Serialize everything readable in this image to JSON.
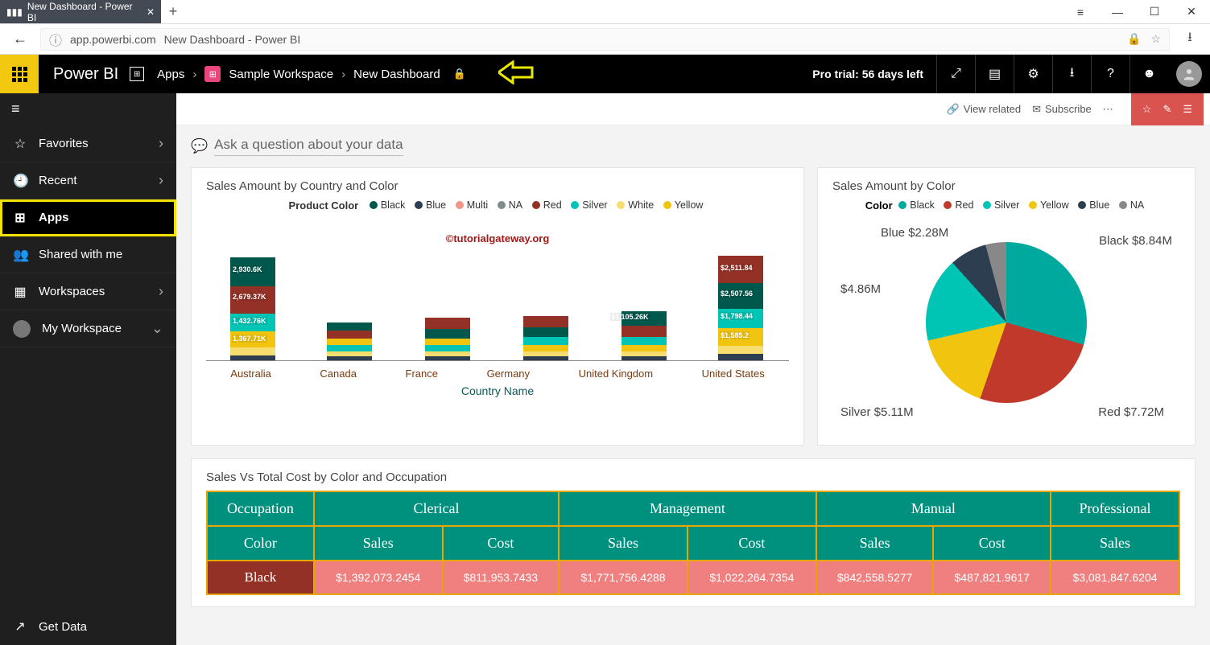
{
  "browser": {
    "tab_title": "New Dashboard - Power BI",
    "url_host": "app.powerbi.com",
    "url_title": "New Dashboard - Power BI"
  },
  "topbar": {
    "brand": "Power BI",
    "crumb_apps": "Apps",
    "crumb_ws": "Sample Workspace",
    "crumb_dash": "New Dashboard",
    "trial": "Pro trial: 56 days left"
  },
  "subbar": {
    "view_related": "View related",
    "subscribe": "Subscribe"
  },
  "sidebar": {
    "fav": "Favorites",
    "recent": "Recent",
    "apps": "Apps",
    "shared": "Shared with me",
    "workspaces": "Workspaces",
    "my_ws": "My Workspace",
    "get_data": "Get Data"
  },
  "qna": {
    "placeholder": "Ask a question about your data"
  },
  "tile1": {
    "title": "Sales Amount by Country and Color",
    "legend_title": "Product Color",
    "watermark": "©tutorialgateway.org",
    "x_title": "Country Name"
  },
  "tile2": {
    "title": "Sales Amount by Color",
    "legend_title": "Color"
  },
  "tile3": {
    "title": "Sales Vs Total Cost by Color and Occupation",
    "occ_hdr": "Occupation",
    "color_hdr": "Color"
  },
  "colors": {
    "black": "#2a2a2a",
    "blue": "#34495e",
    "multi": "#f1948a",
    "na": "#7f8c8d",
    "red": "#943126",
    "silver": "#00c5b5",
    "white": "#f7dc6f",
    "yellow": "#f1c40f",
    "teal": "#00a99d",
    "darkred": "#c0392b"
  },
  "chart_data": [
    {
      "type": "area",
      "title": "Sales Amount by Country and Color",
      "xlabel": "Country Name",
      "ylabel": "",
      "categories": [
        "Australia",
        "Canada",
        "France",
        "Germany",
        "United Kingdom",
        "United States"
      ],
      "legend": [
        "Black",
        "Blue",
        "Multi",
        "NA",
        "Red",
        "Silver",
        "White",
        "Yellow"
      ],
      "australia_labels": [
        "2,930.6K",
        "2,679.37K",
        "1,432.76K",
        "1,367.71K"
      ],
      "uk_label": "$1,105.26K",
      "us_labels": [
        "$2,511.84",
        "$2,507.56",
        "$1,798.44",
        "$1,585.2"
      ]
    },
    {
      "type": "pie",
      "title": "Sales Amount by Color",
      "legend": [
        "Black",
        "Red",
        "Silver",
        "Yellow",
        "Blue",
        "NA"
      ],
      "series": [
        {
          "name": "Black",
          "value": 8.84,
          "label": "Black $8.84M"
        },
        {
          "name": "Red",
          "value": 7.72,
          "label": "Red $7.72M"
        },
        {
          "name": "Silver",
          "value": 5.11,
          "label": "Silver $5.11M"
        },
        {
          "name": "Yellow",
          "value": 4.86,
          "label": "$4.86M"
        },
        {
          "name": "Blue",
          "value": 2.28,
          "label": "Blue $2.28M"
        },
        {
          "name": "NA",
          "value": 1.0,
          "label": "NA"
        }
      ]
    },
    {
      "type": "table",
      "title": "Sales Vs Total Cost by Color and Occupation",
      "columns_top": [
        "Clerical",
        "Management",
        "Manual",
        "Professional"
      ],
      "columns_sub": [
        "Sales",
        "Cost"
      ],
      "rows": [
        {
          "color": "Black",
          "values": [
            "$1,392,073.2454",
            "$811,953.7433",
            "$1,771,756.4288",
            "$1,022,264.7354",
            "$842,558.5277",
            "$487,821.9617",
            "$3,081,847.6204"
          ]
        }
      ]
    }
  ]
}
